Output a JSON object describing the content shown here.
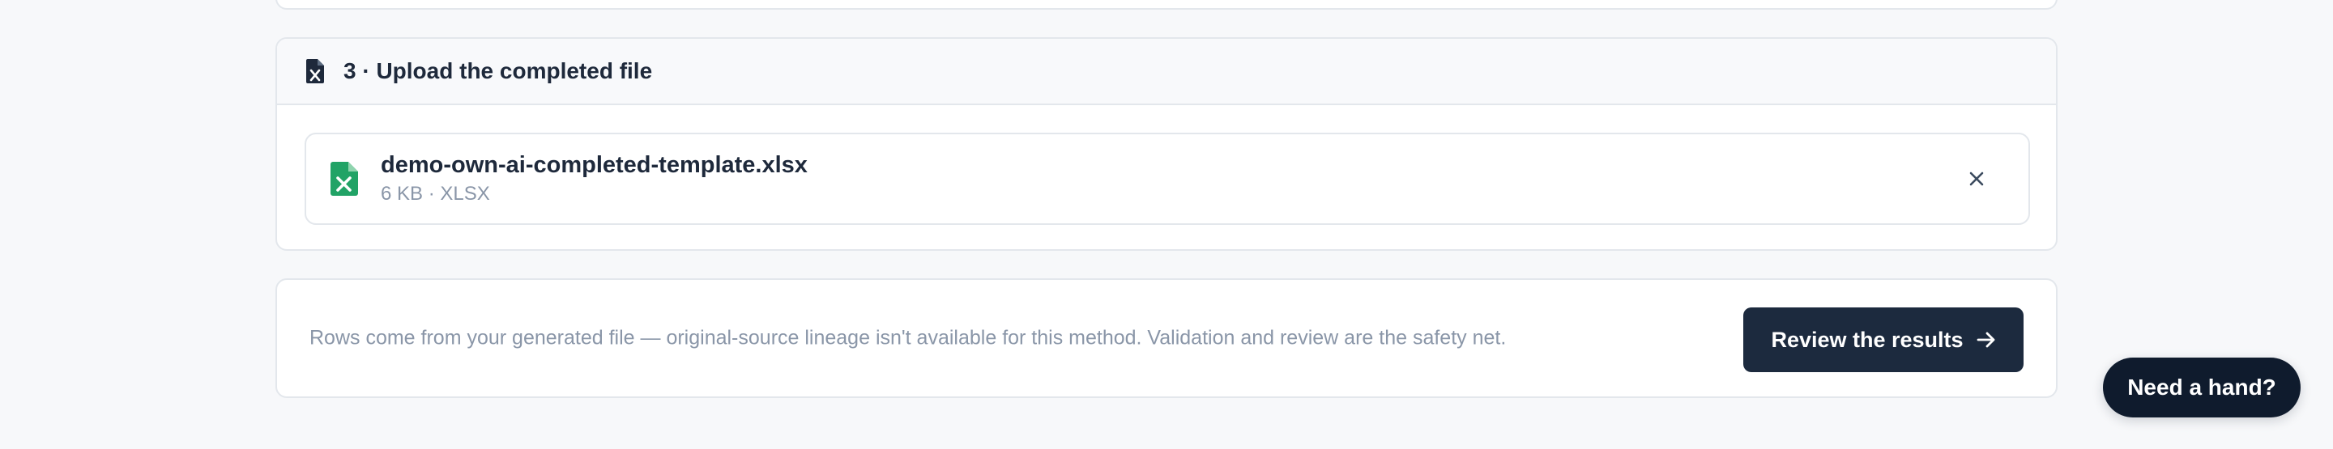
{
  "step": {
    "title": "3 · Upload the completed file",
    "icon": "spreadsheet-file-icon"
  },
  "file": {
    "name": "demo-own-ai-completed-template.xlsx",
    "meta": "6 KB · XLSX",
    "icon": "excel-file-icon",
    "remove_icon": "close-icon"
  },
  "footer": {
    "note": "Rows come from your generated file — original-source lineage isn't available for this method. Validation and review are the safety net.",
    "review_label": "Review the results",
    "review_icon": "arrow-right-icon"
  },
  "help": {
    "label": "Need a hand?"
  },
  "colors": {
    "primary_button": "#1c2a3e",
    "help_button": "#0f1b2d",
    "excel_green": "#21a366",
    "muted_text": "#8a96a8",
    "border": "#e3e7ec"
  }
}
